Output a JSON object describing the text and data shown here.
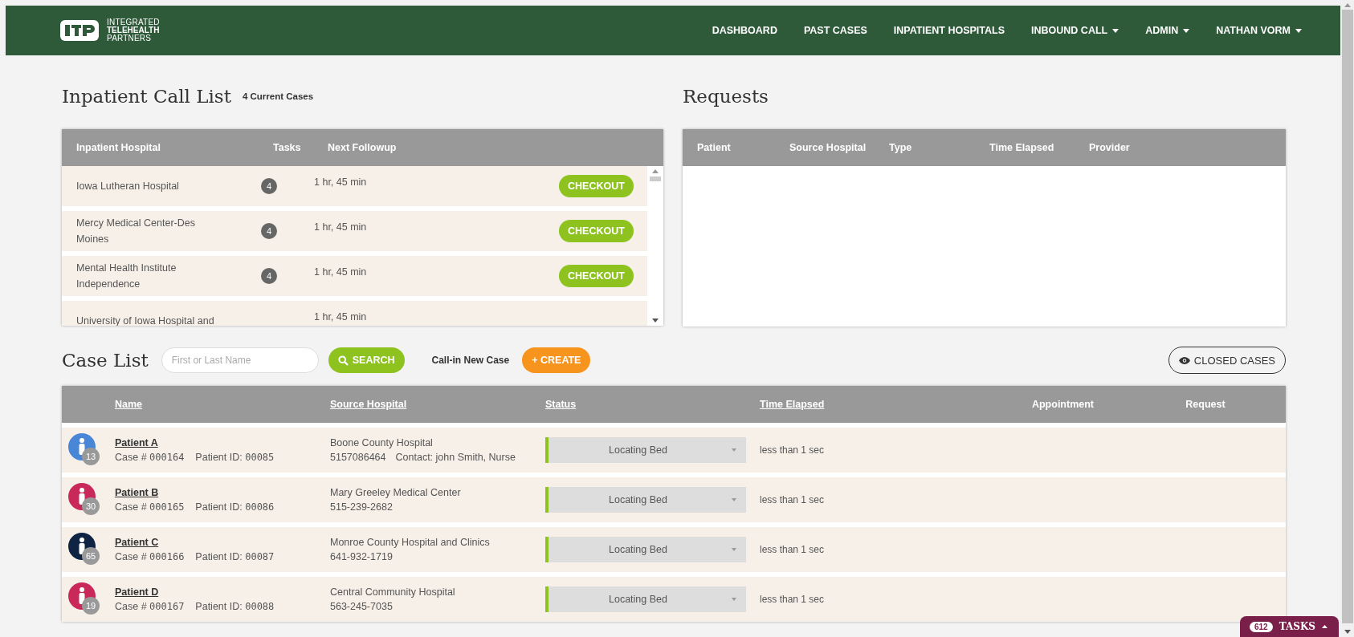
{
  "brand": {
    "line1": "INTEGRATED",
    "line2": "TELEHEALTH",
    "line3": "PARTNERS"
  },
  "nav": [
    {
      "label": "DASHBOARD",
      "dropdown": false
    },
    {
      "label": "PAST CASES",
      "dropdown": false
    },
    {
      "label": "INPATIENT HOSPITALS",
      "dropdown": false
    },
    {
      "label": "INBOUND CALL",
      "dropdown": true
    },
    {
      "label": "ADMIN",
      "dropdown": true
    },
    {
      "label": "NATHAN VORM",
      "dropdown": true
    }
  ],
  "call_list": {
    "title": "Inpatient Call List",
    "count": "4 Current Cases",
    "columns": [
      "Inpatient Hospital",
      "Tasks",
      "Next Followup"
    ],
    "rows": [
      {
        "hospital": "Iowa Lutheran Hospital",
        "tasks": "4",
        "followup": "1 hr, 45 min",
        "action": "CHECKOUT"
      },
      {
        "hospital": "Mercy Medical Center-Des Moines",
        "tasks": "4",
        "followup": "1 hr, 45 min",
        "action": "CHECKOUT"
      },
      {
        "hospital": "Mental Health Institute Independence",
        "tasks": "4",
        "followup": "1 hr, 45 min",
        "action": "CHECKOUT"
      },
      {
        "hospital": "University of Iowa Hospital and",
        "followup": "1 hr, 45 min"
      }
    ]
  },
  "requests": {
    "title": "Requests",
    "columns": [
      "Patient",
      "Source Hospital",
      "Type",
      "Time Elapsed",
      "Provider"
    ]
  },
  "case_list": {
    "title": "Case List",
    "search": {
      "placeholder": "First or Last Name"
    },
    "search_button": "SEARCH",
    "new_case_label": "Call-in New Case",
    "create_button": "+ CREATE",
    "closed_button": "CLOSED CASES",
    "columns": [
      {
        "label": "Name",
        "sortable": true
      },
      {
        "label": "Source Hospital",
        "sortable": true
      },
      {
        "label": "Status",
        "sortable": true
      },
      {
        "label": "Time Elapsed",
        "sortable": true
      },
      {
        "label": "Appointment",
        "sortable": false
      },
      {
        "label": "Request",
        "sortable": false
      }
    ],
    "rows": [
      {
        "name": "Patient A",
        "color": "#4a86d8",
        "age": "13",
        "case_label": "Case #",
        "case_no": "000164",
        "pid_label": "Patient ID:",
        "pid": "00085",
        "hospital": "Boone County Hospital",
        "phone": "5157086464",
        "contact": "Contact: john Smith, Nurse",
        "status": "Locating Bed",
        "elapsed": "less than 1 sec"
      },
      {
        "name": "Patient B",
        "color": "#c8285a",
        "age": "30",
        "case_label": "Case #",
        "case_no": "000165",
        "pid_label": "Patient ID:",
        "pid": "00086",
        "hospital": "Mary Greeley Medical Center",
        "phone": "515-239-2682",
        "status": "Locating Bed",
        "elapsed": "less than 1 sec"
      },
      {
        "name": "Patient C",
        "color": "#0f2342",
        "age": "65",
        "case_label": "Case #",
        "case_no": "000166",
        "pid_label": "Patient ID:",
        "pid": "00087",
        "hospital": "Monroe County Hospital and Clinics",
        "phone": "641-932-1719",
        "status": "Locating Bed",
        "elapsed": "less than 1 sec"
      },
      {
        "name": "Patient D",
        "color": "#c8285a",
        "age": "19",
        "case_label": "Case #",
        "case_no": "000167",
        "pid_label": "Patient ID:",
        "pid": "00088",
        "hospital": "Central Community Hospital",
        "phone": "563-245-7035",
        "status": "Locating Bed",
        "elapsed": "less than 1 sec"
      }
    ]
  },
  "tasks_tab": {
    "count": "612",
    "label": "TASKS"
  }
}
